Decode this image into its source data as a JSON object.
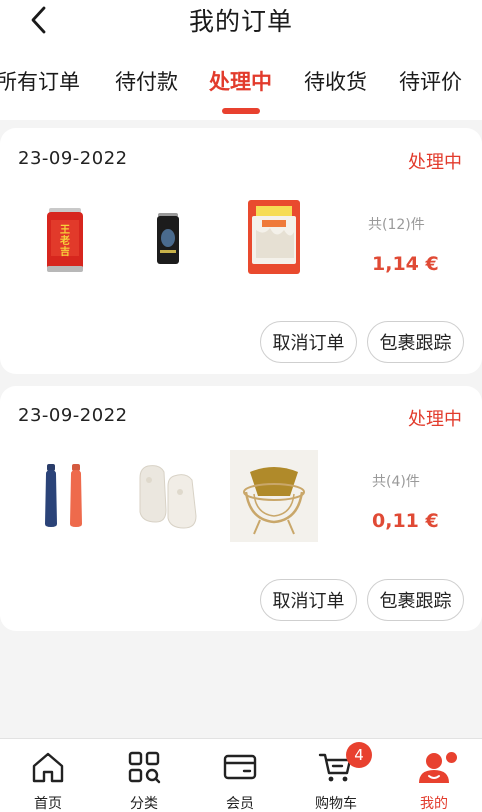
{
  "header": {
    "title": "我的订单",
    "back_icon": "chevron-left-icon"
  },
  "tabs": [
    {
      "label": "所有订单",
      "active": false
    },
    {
      "label": "待付款",
      "active": false
    },
    {
      "label": "处理中",
      "active": true
    },
    {
      "label": "待收货",
      "active": false
    },
    {
      "label": "待评价",
      "active": false
    }
  ],
  "orders": [
    {
      "date": "23-09-2022",
      "status": "处理中",
      "item_count": "共(12)件",
      "total": "1,14 €",
      "products": [
        "red-herbal-tea-can",
        "black-energy-drink-can",
        "rice-noodle-bag"
      ],
      "cancel_label": "取消订单",
      "track_label": "包裹跟踪"
    },
    {
      "date": "23-09-2022",
      "status": "处理中",
      "item_count": "共(4)件",
      "total": "0,11 €",
      "products": [
        "water-bottles",
        "fluffy-slippers",
        "wicker-basket"
      ],
      "cancel_label": "取消订单",
      "track_label": "包裹跟踪"
    }
  ],
  "bottom_nav": [
    {
      "label": "首页",
      "icon": "home-icon",
      "active": false
    },
    {
      "label": "分类",
      "icon": "category-icon",
      "active": false
    },
    {
      "label": "会员",
      "icon": "member-card-icon",
      "active": false
    },
    {
      "label": "购物车",
      "icon": "cart-icon",
      "badge": "4",
      "active": false
    },
    {
      "label": "我的",
      "icon": "profile-icon",
      "active": true
    }
  ],
  "colors": {
    "accent": "#e23b2c",
    "price": "#e04a35",
    "background": "#f4f4f4"
  }
}
